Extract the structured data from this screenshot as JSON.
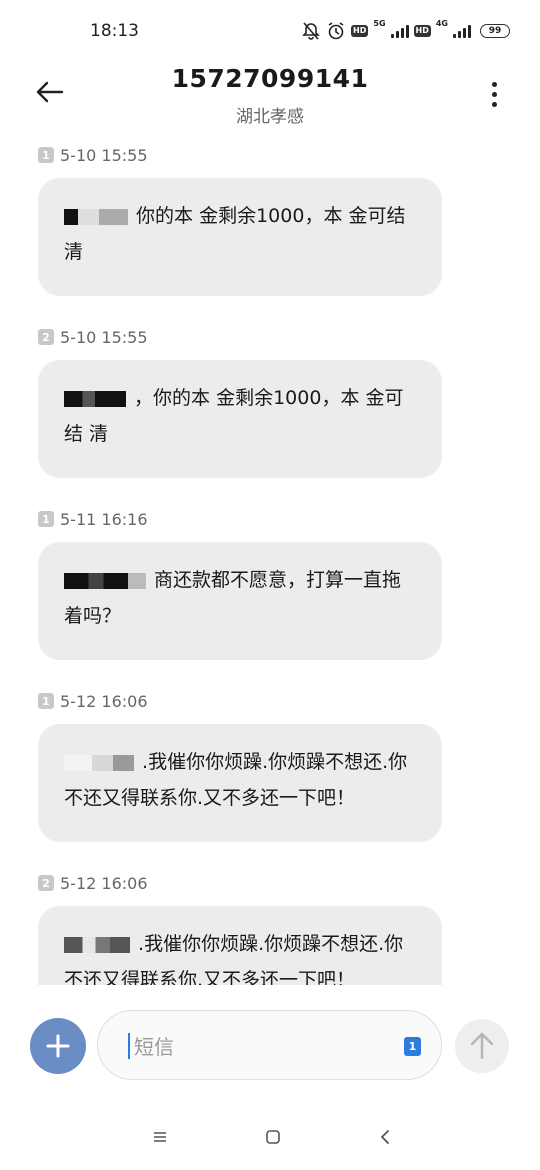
{
  "status_bar": {
    "time": "18:13",
    "network1": "5G",
    "network2": "4G",
    "hd": "HD",
    "battery": "99"
  },
  "header": {
    "title": "15727099141",
    "subtitle": "湖北孝感"
  },
  "messages": [
    {
      "sim": "1",
      "time": "5-10 15:55",
      "text": "你的本 金剩余1000，本 金可结 清"
    },
    {
      "sim": "2",
      "time": "5-10 15:55",
      "text": "，你的本 金剩余1000，本 金可结 清"
    },
    {
      "sim": "1",
      "time": "5-11 16:16",
      "text": "商还款都不愿意，打算一直拖着吗？"
    },
    {
      "sim": "1",
      "time": "5-12 16:06",
      "text": ".我催你你烦躁.你烦躁不想还.你不还又得联系你.又不多还一下吧！"
    },
    {
      "sim": "2",
      "time": "5-12 16:06",
      "text": ".我催你你烦躁.你烦躁不想还.你不还又得联系你.又不多还一下吧！"
    }
  ],
  "input": {
    "placeholder": "短信",
    "sim_selected": "1"
  },
  "colors": {
    "add_button": "#6a8dc6",
    "bubble": "#ececec",
    "accent": "#2b7be0"
  },
  "icons": {
    "back": "arrow-left-icon",
    "more": "more-vertical-icon",
    "add": "plus-icon",
    "send": "arrow-up-icon",
    "nav_menu": "menu-icon",
    "nav_home": "square-icon",
    "nav_back": "chevron-left-icon"
  }
}
